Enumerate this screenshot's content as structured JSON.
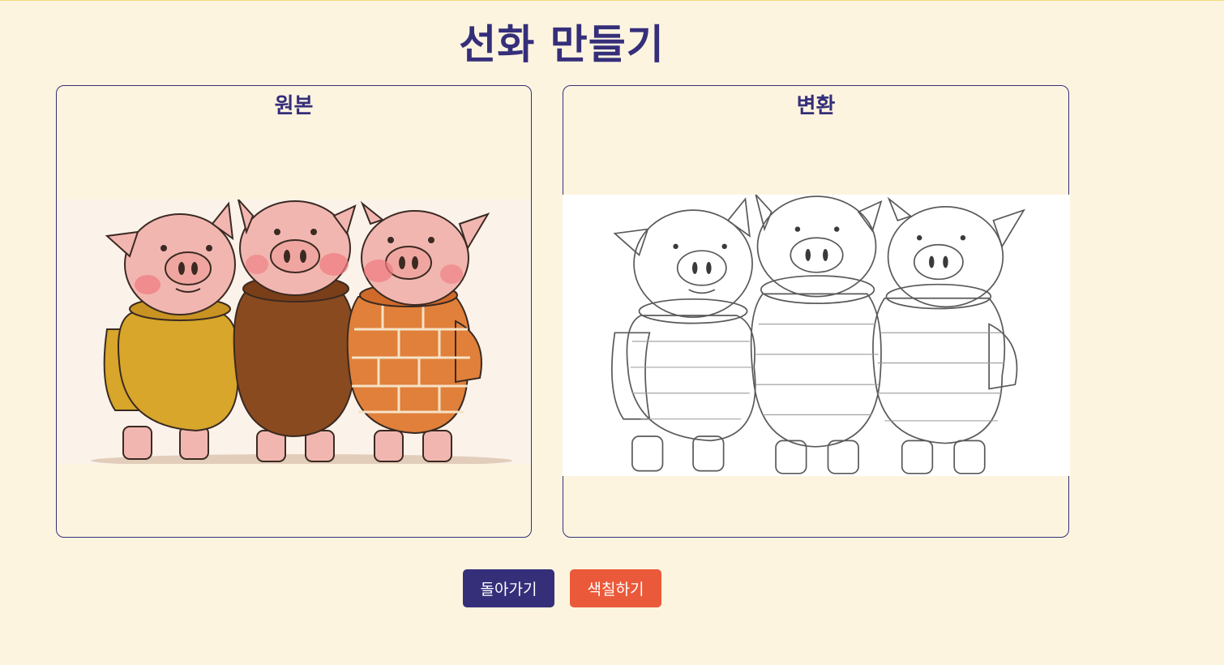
{
  "page": {
    "title": "선화 만들기"
  },
  "panels": {
    "original": {
      "title": "원본",
      "image": "three-little-pigs-color-illustration"
    },
    "converted": {
      "title": "변환",
      "image": "three-little-pigs-line-drawing"
    }
  },
  "buttons": {
    "back_label": "돌아가기",
    "colorize_label": "색칠하기"
  },
  "colors": {
    "background": "#fdf4e0",
    "primary": "#352f7a",
    "accent": "#ea5a3a",
    "pig_skin": "#f2b6b0",
    "sweater_yellow": "#d7a62a",
    "sweater_brown": "#8a4a1f",
    "sweater_orange": "#e0803a"
  }
}
